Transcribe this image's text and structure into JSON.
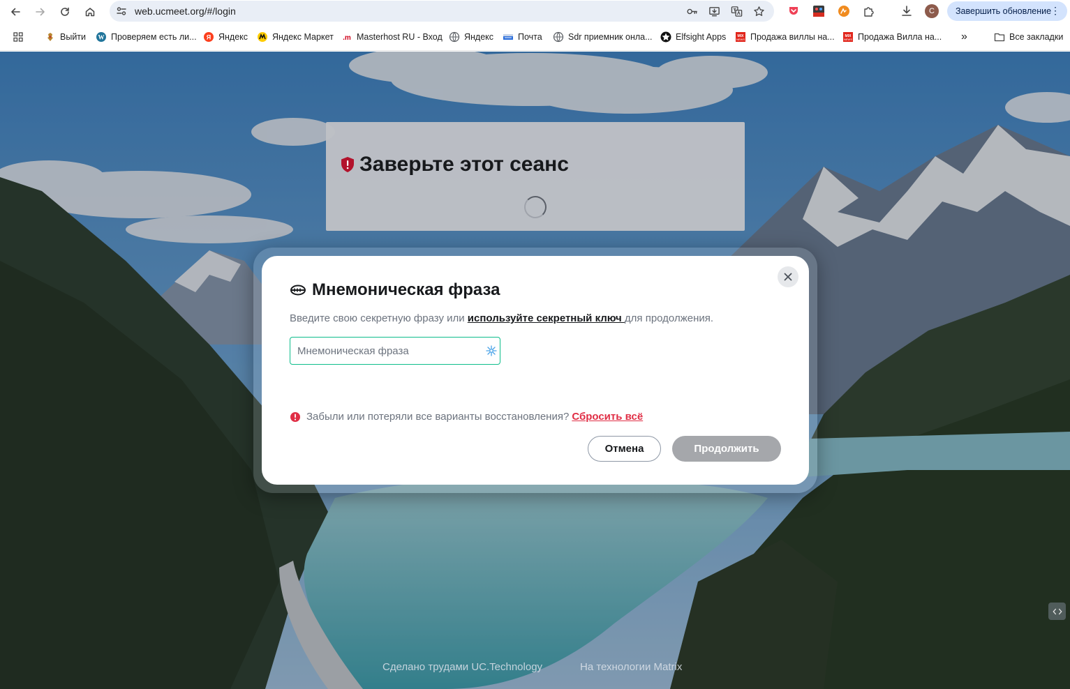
{
  "browser": {
    "url": "web.ucmeet.org/#/login",
    "profile_initial": "C",
    "update_button_label": "Завершить обновление",
    "menu_glyph": "⋮"
  },
  "bookmarks": {
    "items": [
      {
        "label": "Выйти",
        "icon": "crest-icon"
      },
      {
        "label": "Проверяем есть ли...",
        "icon": "wordpress-icon"
      },
      {
        "label": "Яндекс",
        "icon": "yandex-icon"
      },
      {
        "label": "Яндекс Маркет",
        "icon": "yandex-market-icon"
      },
      {
        "label": "Masterhost RU - Вход",
        "icon": "masterhost-icon"
      },
      {
        "label": "Яндекс",
        "icon": "globe-icon"
      },
      {
        "label": "Почта",
        "icon": "mail-icon"
      },
      {
        "label": "Sdr приемник онла...",
        "icon": "globe-icon"
      },
      {
        "label": "Elfsight Apps",
        "icon": "elfsight-icon"
      },
      {
        "label": "Продажа виллы на...",
        "icon": "mix-icon"
      },
      {
        "label": "Продажа Вилла на...",
        "icon": "mix-icon"
      }
    ],
    "more_glyph": "»",
    "all_bookmarks_label": "Все закладки"
  },
  "session": {
    "title": "Заверьте этот сеанс"
  },
  "dialog": {
    "title": "Мнемоническая фраза",
    "desc_before": "Введите свою секретную фразу или ",
    "desc_link": "используйте секретный ключ ",
    "desc_after": "для продолжения.",
    "phrase_placeholder": "Мнемоническая фраза",
    "phrase_value": "",
    "warn_text": "Забыли или потеряли все варианты восстановления?",
    "reset_link": "Сбросить всё",
    "cancel_label": "Отмена",
    "continue_label": "Продолжить"
  },
  "footer": {
    "made_by": "Сделано трудами UC.Technology",
    "powered_by": "На технологии Matrix"
  },
  "colors": {
    "accent_green": "#0dbd8b",
    "danger_red": "#e02e45",
    "update_button_bg": "#d3e3fd",
    "continue_disabled": "#a5a7ab"
  }
}
